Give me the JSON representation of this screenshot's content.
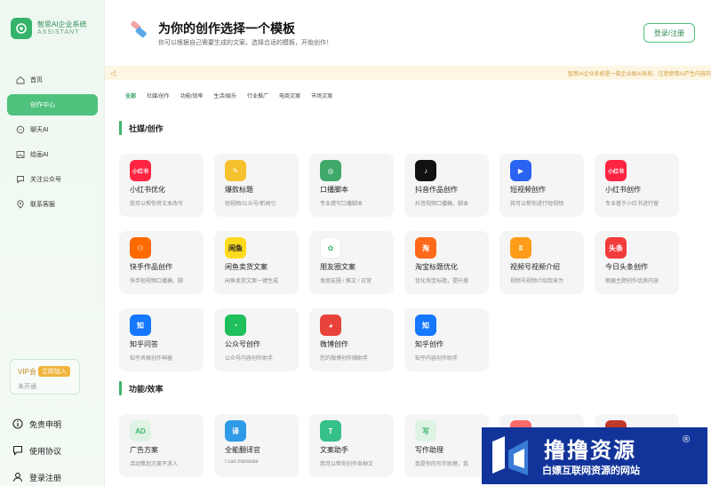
{
  "brand": {
    "name": "智思AI企业系统",
    "sub": "ASSISTANT"
  },
  "nav": [
    {
      "label": "首页",
      "icon": "home-icon"
    },
    {
      "label": "创作中心",
      "icon": "",
      "active": true
    },
    {
      "label": "聊天AI",
      "icon": "chat-icon"
    },
    {
      "label": "绘画AI",
      "icon": "image-icon"
    },
    {
      "label": "关注公众号",
      "icon": "follow-icon"
    },
    {
      "label": "联系客服",
      "icon": "location-icon"
    }
  ],
  "vip": {
    "label": "VIP会",
    "button": "立即加入",
    "status": "未开通"
  },
  "side_bottom": [
    {
      "label": "免责申明",
      "icon": "info-icon"
    },
    {
      "label": "使用协议",
      "icon": "agreement-icon"
    },
    {
      "label": "登录注册",
      "icon": "user-icon"
    }
  ],
  "header": {
    "title": "为你的创作选择一个模板",
    "desc": "你可以根据自己需要生成的文案，选择合适的模板，开始创作！",
    "login": "登录/注册"
  },
  "notice": {
    "icon": "speaker-icon",
    "text": "智思AI企业系统是一款企业级AI系统，注意使用AI产生内容的"
  },
  "tabs": [
    "全部",
    "社媒/创作",
    "功能/效率",
    "生活/娱乐",
    "行业推广",
    "电商文案",
    "市场文案"
  ],
  "sections": [
    {
      "title": "社媒/创作"
    },
    {
      "title": "功能/效率"
    }
  ],
  "cards": [
    {
      "title": "小红书优化",
      "desc": "我可以帮你将文本改写",
      "icon_text": "小红书",
      "color": "#ff2442"
    },
    {
      "title": "爆款标题",
      "desc": "短视频/公众号/新闻引",
      "icon_text": "✎",
      "color": "#f6c12e"
    },
    {
      "title": "口播脚本",
      "desc": "专业撰写口播脚本",
      "icon_text": "◎",
      "color": "#3fa96a"
    },
    {
      "title": "抖音作品创作",
      "desc": "抖音视频口播稿、脚本",
      "icon_text": "♪",
      "color": "#111111"
    },
    {
      "title": "短视频创作",
      "desc": "我可以帮你进行短视频",
      "icon_text": "▶",
      "color": "#2a64f0"
    },
    {
      "title": "小红书创作",
      "desc": "专业基于小红书进行营",
      "icon_text": "小红书",
      "color": "#ff2442"
    },
    {
      "title": "快手作品创作",
      "desc": "快手短视频口播稿、脚",
      "icon_text": "⚇",
      "color": "#ff6a00"
    },
    {
      "title": "闲鱼卖货文案",
      "desc": "闲鱼卖货文案一键生成",
      "icon_text": "闲鱼",
      "color": "#ffdb1f"
    },
    {
      "title": "朋友圈文案",
      "desc": "发朋友圈 / 推文 / 日常",
      "icon_text": "✿",
      "color": "#ffffff"
    },
    {
      "title": "淘宝标题优化",
      "desc": "优化淘宝标题，提升搜",
      "icon_text": "淘",
      "color": "#ff6a1a"
    },
    {
      "title": "视频号视频介绍",
      "desc": "视频号视频介绍我来为",
      "icon_text": "ʬ",
      "color": "#ff9c1a"
    },
    {
      "title": "今日头条创作",
      "desc": "根据主题创作优质内容",
      "icon_text": "头条",
      "color": "#f23b3b"
    },
    {
      "title": "知乎问答",
      "desc": "知乎风格创作神器",
      "icon_text": "知",
      "color": "#1677ff"
    },
    {
      "title": "公众号创作",
      "desc": "公众号内容创作助手",
      "icon_text": "◔",
      "color": "#1fbf5b"
    },
    {
      "title": "微博创作",
      "desc": "您的微博创作辅助手",
      "icon_text": "◕",
      "color": "#e8433b"
    },
    {
      "title": "知乎创作",
      "desc": "知乎内容创作助手",
      "icon_text": "知",
      "color": "#1677ff"
    },
    {
      "title": "广告方案",
      "desc": "活动策划方案不求人",
      "icon_text": "AD",
      "color": "#dff3e4"
    },
    {
      "title": "全能翻译官",
      "desc": "I can translate",
      "icon_text": "译",
      "color": "#2f9be6"
    },
    {
      "title": "文案助手",
      "desc": "我可以帮你创作各种文",
      "icon_text": "T",
      "color": "#36c08a"
    },
    {
      "title": "写作助理",
      "desc": "我是你的写作助理，我",
      "icon_text": "写",
      "color": "#dff3e4"
    },
    {
      "title": "",
      "desc": "",
      "icon_text": "▣",
      "color": "#ff6b6b"
    },
    {
      "title": "",
      "desc": "",
      "icon_text": "✦",
      "color": "#c0392b"
    }
  ],
  "watermark": {
    "title": "撸撸资源",
    "reg": "®",
    "sub": "白嫖互联网资源的网站"
  },
  "colors": {
    "accent": "#4fc27d",
    "sidebar_bg": "#eef8f0",
    "notice_bg": "#fdf6e3"
  }
}
